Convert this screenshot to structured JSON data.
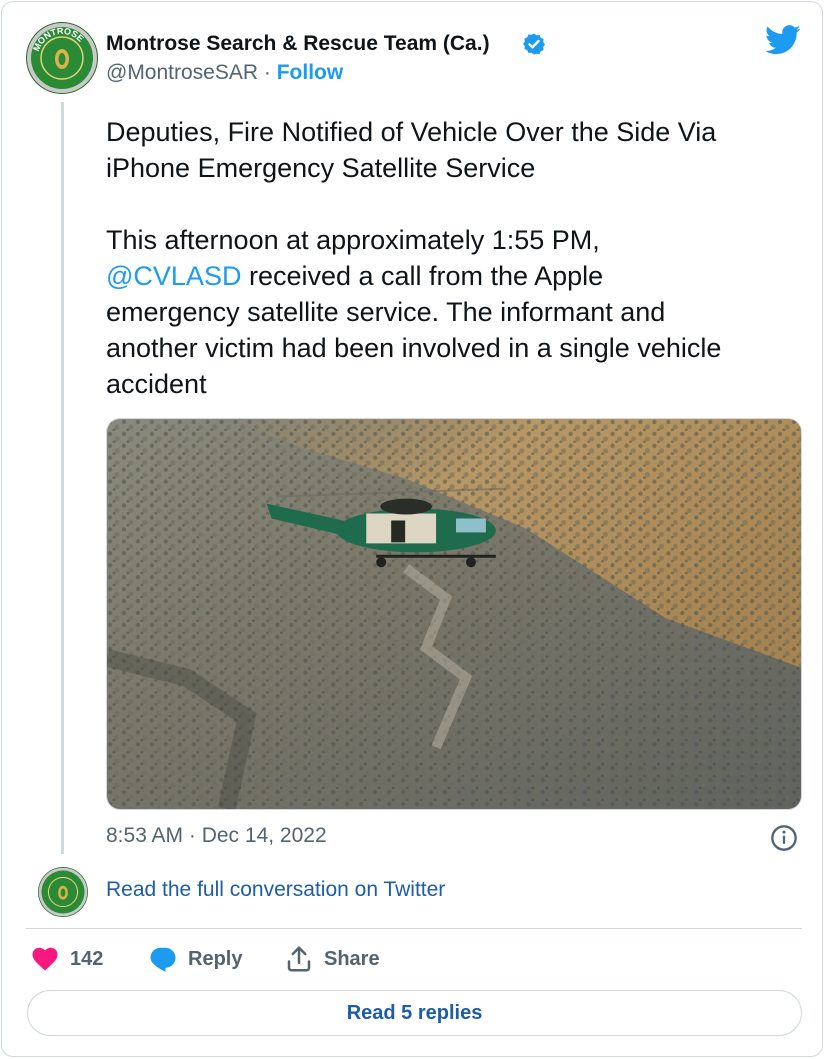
{
  "author": {
    "name": "Montrose Search & Rescue Team (Ca.)",
    "handle": "@MontroseSAR",
    "separator": "·",
    "follow_label": "Follow",
    "avatar_text": "MONTROSE"
  },
  "tweet": {
    "lines": [
      "Deputies, Fire Notified of Vehicle Over the Side Via",
      "iPhone Emergency Satellite Service",
      "",
      "This afternoon at approximately 1:55 PM,",
      "",
      "emergency satellite service. The informant and",
      "another victim had been involved in a single vehicle",
      "accident"
    ],
    "mention": "@CVLASD",
    "after_mention": " received a call from the Apple",
    "timestamp": "8:53 AM · Dec 14, 2022"
  },
  "conversation_link": "Read the full conversation on Twitter",
  "actions": {
    "like_count": "142",
    "reply_label": "Reply",
    "share_label": "Share"
  },
  "read_replies_label": "Read 5 replies",
  "colors": {
    "link": "#1d9bf0",
    "like": "#f91880",
    "muted": "#536471",
    "border": "#cfd9de"
  },
  "icons": [
    "verified-badge-icon",
    "twitter-bird-icon",
    "info-icon",
    "heart-icon",
    "reply-bubble-icon",
    "share-icon"
  ]
}
